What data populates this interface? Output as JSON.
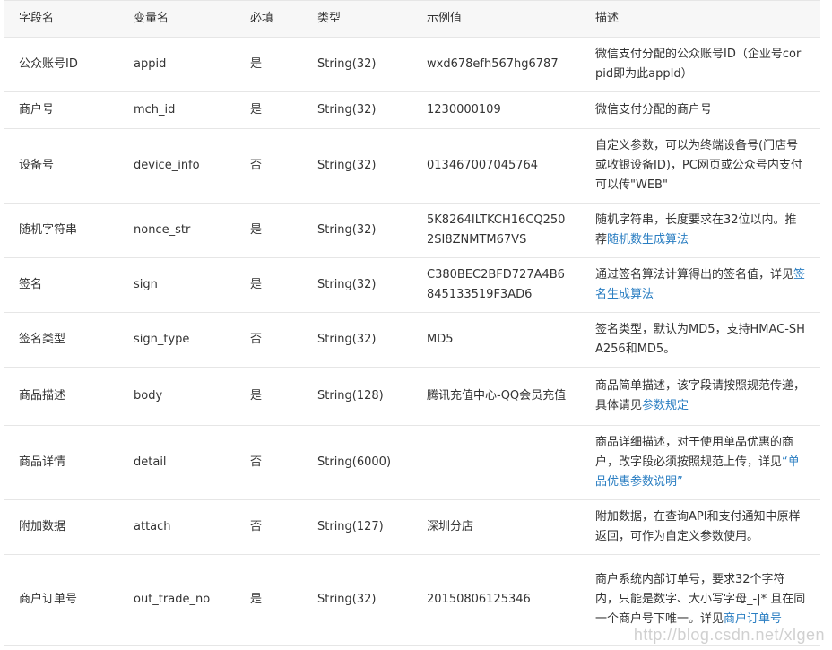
{
  "headers": {
    "field": "字段名",
    "var": "变量名",
    "required": "必填",
    "type": "类型",
    "example": "示例值",
    "desc": "描述"
  },
  "rows": [
    {
      "field": "公众账号ID",
      "var": "appid",
      "required": "是",
      "type": "String(32)",
      "example": "wxd678efh567hg6787",
      "desc_pre": "微信支付分配的公众账号ID（企业号corpid即为此appId）",
      "desc_link": "",
      "desc_post": ""
    },
    {
      "field": "商户号",
      "var": "mch_id",
      "required": "是",
      "type": "String(32)",
      "example": "1230000109",
      "desc_pre": "微信支付分配的商户号",
      "desc_link": "",
      "desc_post": ""
    },
    {
      "field": "设备号",
      "var": "device_info",
      "required": "否",
      "type": "String(32)",
      "example": "013467007045764",
      "desc_pre": "自定义参数，可以为终端设备号(门店号或收银设备ID)，PC网页或公众号内支付可以传\"WEB\"",
      "desc_link": "",
      "desc_post": ""
    },
    {
      "field": "随机字符串",
      "var": "nonce_str",
      "required": "是",
      "type": "String(32)",
      "example": "5K8264ILTKCH16CQ2502SI8ZNMTM67VS",
      "desc_pre": "随机字符串，长度要求在32位以内。推荐",
      "desc_link": "随机数生成算法",
      "desc_post": ""
    },
    {
      "field": "签名",
      "var": "sign",
      "required": "是",
      "type": "String(32)",
      "example": "C380BEC2BFD727A4B6845133519F3AD6",
      "desc_pre": "通过签名算法计算得出的签名值，详见",
      "desc_link": "签名生成算法",
      "desc_post": ""
    },
    {
      "field": "签名类型",
      "var": "sign_type",
      "required": "否",
      "type": "String(32)",
      "example": "MD5",
      "desc_pre": "签名类型，默认为MD5，支持HMAC-SHA256和MD5。",
      "desc_link": "",
      "desc_post": ""
    },
    {
      "field": "商品描述",
      "var": "body",
      "required": "是",
      "type": "String(128)",
      "example": "腾讯充值中心-QQ会员充值",
      "desc_pre": "商品简单描述，该字段请按照规范传递，具体请见",
      "desc_link": "参数规定",
      "desc_post": ""
    },
    {
      "field": "商品详情",
      "var": "detail",
      "required": "否",
      "type": "String(6000)",
      "example": "",
      "desc_pre": "商品详细描述，对于使用单品优惠的商户，改字段必须按照规范上传，详见",
      "desc_link": "“单品优惠参数说明”",
      "desc_post": ""
    },
    {
      "field": "附加数据",
      "var": "attach",
      "required": "否",
      "type": "String(127)",
      "example": "深圳分店",
      "desc_pre": "附加数据，在查询API和支付通知中原样返回，可作为自定义参数使用。",
      "desc_link": "",
      "desc_post": ""
    },
    {
      "field": "商户订单号",
      "var": "out_trade_no",
      "required": "是",
      "type": "String(32)",
      "example": "20150806125346",
      "desc_pre": "商户系统内部订单号，要求32个字符内，只能是数字、大小写字母_-|* 且在同一个商户号下唯一。详见",
      "desc_link": "商户订单号",
      "desc_post": ""
    }
  ],
  "watermark": "http://blog.csdn.net/xlgen"
}
